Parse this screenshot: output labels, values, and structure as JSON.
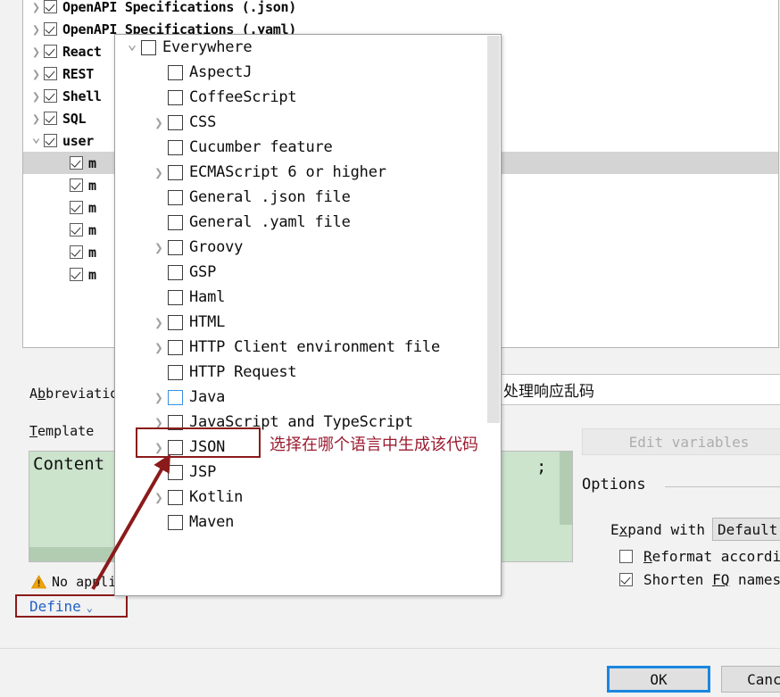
{
  "tree": {
    "rows": [
      {
        "label": "OpenAPI Specifications (.json)",
        "checked": true,
        "chevron": "right",
        "indent": 0,
        "selected": false
      },
      {
        "label": "OpenAPI Specifications (.yaml)",
        "checked": true,
        "chevron": "right",
        "indent": 0,
        "selected": false
      },
      {
        "label": "React",
        "checked": true,
        "chevron": "right",
        "indent": 0,
        "selected": false
      },
      {
        "label": "REST",
        "checked": true,
        "chevron": "right",
        "indent": 0,
        "selected": false
      },
      {
        "label": "Shell",
        "checked": true,
        "chevron": "right",
        "indent": 0,
        "selected": false
      },
      {
        "label": "SQL",
        "checked": true,
        "chevron": "right",
        "indent": 0,
        "selected": false
      },
      {
        "label": "user",
        "checked": true,
        "chevron": "down",
        "indent": 0,
        "selected": false
      },
      {
        "label": "m",
        "checked": true,
        "chevron": "none",
        "indent": 1,
        "selected": true
      },
      {
        "label": "m",
        "checked": true,
        "chevron": "none",
        "indent": 1,
        "selected": false
      },
      {
        "label": "m",
        "checked": true,
        "chevron": "none",
        "indent": 1,
        "selected": false
      },
      {
        "label": "m",
        "checked": true,
        "chevron": "none",
        "indent": 1,
        "selected": false
      },
      {
        "label": "m",
        "checked": true,
        "chevron": "none",
        "indent": 1,
        "selected": false
      },
      {
        "label": "m",
        "checked": true,
        "chevron": "none",
        "indent": 1,
        "selected": false
      }
    ]
  },
  "form": {
    "abbreviation_label_pre": "A",
    "abbreviation_label_mn": "b",
    "abbreviation_label_post": "breviation",
    "template_label_mn": "T",
    "template_label_post": "emplate",
    "description_value": "处理响应乱码",
    "editor_text_left": "Content",
    "editor_text_right": ";",
    "warning_text": "No applicable contexts",
    "define_label": "Define",
    "define_chevron": "⌄"
  },
  "options": {
    "edit_variables_label": "Edit variables",
    "title": "Options",
    "expand_with_label_pre": "E",
    "expand_with_label_mn": "x",
    "expand_with_label_post": "pand with",
    "expand_with_value": "Default",
    "reformat_label_mn": "R",
    "reformat_label_post": "eformat according to style",
    "reformat_checked": false,
    "shorten_label_pre": "Shorten ",
    "shorten_label_mn": "FQ",
    "shorten_label_post": " names",
    "shorten_checked": true
  },
  "popup": {
    "items": [
      {
        "label": "Everywhere",
        "chevron": "down",
        "indent": 0,
        "checked": false,
        "focused": false
      },
      {
        "label": "AspectJ",
        "chevron": "none",
        "indent": 1,
        "checked": false,
        "focused": false
      },
      {
        "label": "CoffeeScript",
        "chevron": "none",
        "indent": 1,
        "checked": false,
        "focused": false
      },
      {
        "label": "CSS",
        "chevron": "right",
        "indent": 1,
        "checked": false,
        "focused": false
      },
      {
        "label": "Cucumber feature",
        "chevron": "none",
        "indent": 1,
        "checked": false,
        "focused": false
      },
      {
        "label": "ECMAScript 6 or higher",
        "chevron": "right",
        "indent": 1,
        "checked": false,
        "focused": false
      },
      {
        "label": "General .json file",
        "chevron": "none",
        "indent": 1,
        "checked": false,
        "focused": false
      },
      {
        "label": "General .yaml file",
        "chevron": "none",
        "indent": 1,
        "checked": false,
        "focused": false
      },
      {
        "label": "Groovy",
        "chevron": "right",
        "indent": 1,
        "checked": false,
        "focused": false
      },
      {
        "label": "GSP",
        "chevron": "none",
        "indent": 1,
        "checked": false,
        "focused": false
      },
      {
        "label": "Haml",
        "chevron": "none",
        "indent": 1,
        "checked": false,
        "focused": false
      },
      {
        "label": "HTML",
        "chevron": "right",
        "indent": 1,
        "checked": false,
        "focused": false
      },
      {
        "label": "HTTP Client environment file",
        "chevron": "right",
        "indent": 1,
        "checked": false,
        "focused": false
      },
      {
        "label": "HTTP Request",
        "chevron": "none",
        "indent": 1,
        "checked": false,
        "focused": false
      },
      {
        "label": "Java",
        "chevron": "right",
        "indent": 1,
        "checked": false,
        "focused": true
      },
      {
        "label": "JavaScript and TypeScript",
        "chevron": "right",
        "indent": 1,
        "checked": false,
        "focused": false
      },
      {
        "label": "JSON",
        "chevron": "right",
        "indent": 1,
        "checked": false,
        "focused": false
      },
      {
        "label": "JSP",
        "chevron": "none",
        "indent": 1,
        "checked": false,
        "focused": false
      },
      {
        "label": "Kotlin",
        "chevron": "right",
        "indent": 1,
        "checked": false,
        "focused": false
      },
      {
        "label": "Maven",
        "chevron": "none",
        "indent": 1,
        "checked": false,
        "focused": false
      }
    ]
  },
  "annotation": {
    "text": "选择在哪个语言中生成该代码",
    "color": "#9b1b30"
  },
  "footer": {
    "ok_label": "OK",
    "cancel_label": "Cancel"
  },
  "colors": {
    "accent_blue": "#1a86e0",
    "annotation_red": "#8b1a1a",
    "link_blue": "#2161c4",
    "editor_green": "#cce3cc"
  }
}
